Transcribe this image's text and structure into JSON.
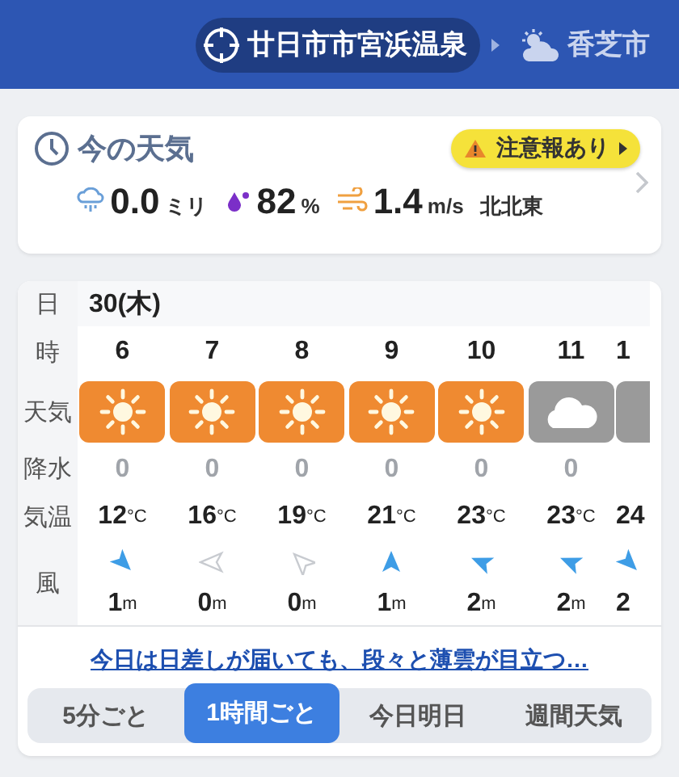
{
  "header": {
    "locations": [
      {
        "name": "廿日市市宮浜温泉",
        "kind": "current",
        "selected": true
      },
      {
        "name": "香芝市",
        "kind": "partly-cloudy",
        "selected": false
      }
    ]
  },
  "now": {
    "title": "今の天気",
    "alert": "注意報あり",
    "rain": {
      "value": "0.0",
      "unit": "ミリ"
    },
    "humidity": {
      "value": "82",
      "unit": "%"
    },
    "wind": {
      "value": "1.4",
      "unit": "m/s",
      "direction": "北北東"
    }
  },
  "hourly": {
    "row_labels": [
      "日",
      "時",
      "天気",
      "降水",
      "気温",
      "風"
    ],
    "date": "30(木)",
    "hours": [
      {
        "hour": "6",
        "kind": "sunny",
        "rain": "0",
        "temp": "12",
        "temp_unit": "°C",
        "wind_arrow": {
          "kind": "SE",
          "calm": false
        },
        "wind": "1",
        "wind_unit": "m"
      },
      {
        "hour": "7",
        "kind": "sunny",
        "rain": "0",
        "temp": "16",
        "temp_unit": "°C",
        "wind_arrow": {
          "kind": "W",
          "calm": true
        },
        "wind": "0",
        "wind_unit": "m"
      },
      {
        "hour": "8",
        "kind": "sunny",
        "rain": "0",
        "temp": "19",
        "temp_unit": "°C",
        "wind_arrow": {
          "kind": "NW",
          "calm": true
        },
        "wind": "0",
        "wind_unit": "m"
      },
      {
        "hour": "9",
        "kind": "sunny",
        "rain": "0",
        "temp": "21",
        "temp_unit": "°C",
        "wind_arrow": {
          "kind": "N",
          "calm": false
        },
        "wind": "1",
        "wind_unit": "m"
      },
      {
        "hour": "10",
        "kind": "sunny",
        "rain": "0",
        "temp": "23",
        "temp_unit": "°C",
        "wind_arrow": {
          "kind": "WNW",
          "calm": false
        },
        "wind": "2",
        "wind_unit": "m"
      },
      {
        "hour": "11",
        "kind": "cloudy",
        "rain": "0",
        "temp": "23",
        "temp_unit": "°C",
        "wind_arrow": {
          "kind": "WNW",
          "calm": false
        },
        "wind": "2",
        "wind_unit": "m"
      },
      {
        "hour": "1",
        "kind": "cloudy",
        "temp": "24",
        "wind_arrow": {
          "kind": "SE",
          "calm": false
        },
        "wind": "2"
      }
    ],
    "summary_link": "今日は日差しが届いても、段々と薄雲が目立つ…"
  },
  "tabs": [
    {
      "label": "5分ごと",
      "selected": false
    },
    {
      "label": "1時間ごと",
      "selected": true
    },
    {
      "label": "今日明日",
      "selected": false
    },
    {
      "label": "週間天気",
      "selected": false
    }
  ]
}
